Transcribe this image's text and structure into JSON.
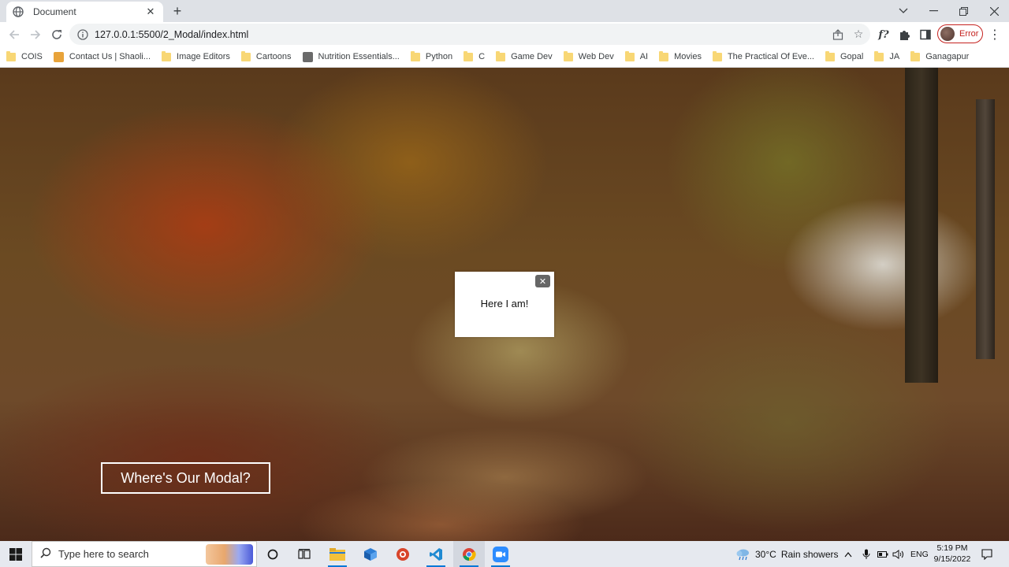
{
  "browser": {
    "tab": {
      "title": "Document"
    },
    "address_bar": {
      "url": "127.0.0.1:5500/2_Modal/index.html"
    },
    "profile": {
      "status": "Error"
    },
    "extension_label": "f?"
  },
  "bookmarks": [
    {
      "label": "COIS",
      "icon": "folder-icon"
    },
    {
      "label": "Contact Us | Shaoli...",
      "icon": "site-icon"
    },
    {
      "label": "Image Editors",
      "icon": "folder-icon"
    },
    {
      "label": "Cartoons",
      "icon": "folder-icon"
    },
    {
      "label": "Nutrition Essentials...",
      "icon": "site-icon"
    },
    {
      "label": "Python",
      "icon": "folder-icon"
    },
    {
      "label": "C",
      "icon": "folder-icon"
    },
    {
      "label": "Game Dev",
      "icon": "folder-icon"
    },
    {
      "label": "Web Dev",
      "icon": "folder-icon"
    },
    {
      "label": "AI",
      "icon": "folder-icon"
    },
    {
      "label": "Movies",
      "icon": "folder-icon"
    },
    {
      "label": "The Practical Of Eve...",
      "icon": "folder-icon"
    },
    {
      "label": "Gopal",
      "icon": "folder-icon"
    },
    {
      "label": "JA",
      "icon": "folder-icon"
    },
    {
      "label": "Ganagapur",
      "icon": "folder-icon"
    }
  ],
  "page": {
    "modal": {
      "text": "Here I am!",
      "close_glyph": "✕"
    },
    "open_button": {
      "label": "Where's Our Modal?"
    }
  },
  "taskbar": {
    "search_placeholder": "Type here to search",
    "weather": {
      "temp": "30°C",
      "condition": "Rain showers"
    },
    "language": "ENG",
    "time": "5:19 PM",
    "date": "9/15/2022"
  },
  "colors": {
    "accent": "#0078d7",
    "error": "#c5221f",
    "folder": "#f8d775"
  }
}
